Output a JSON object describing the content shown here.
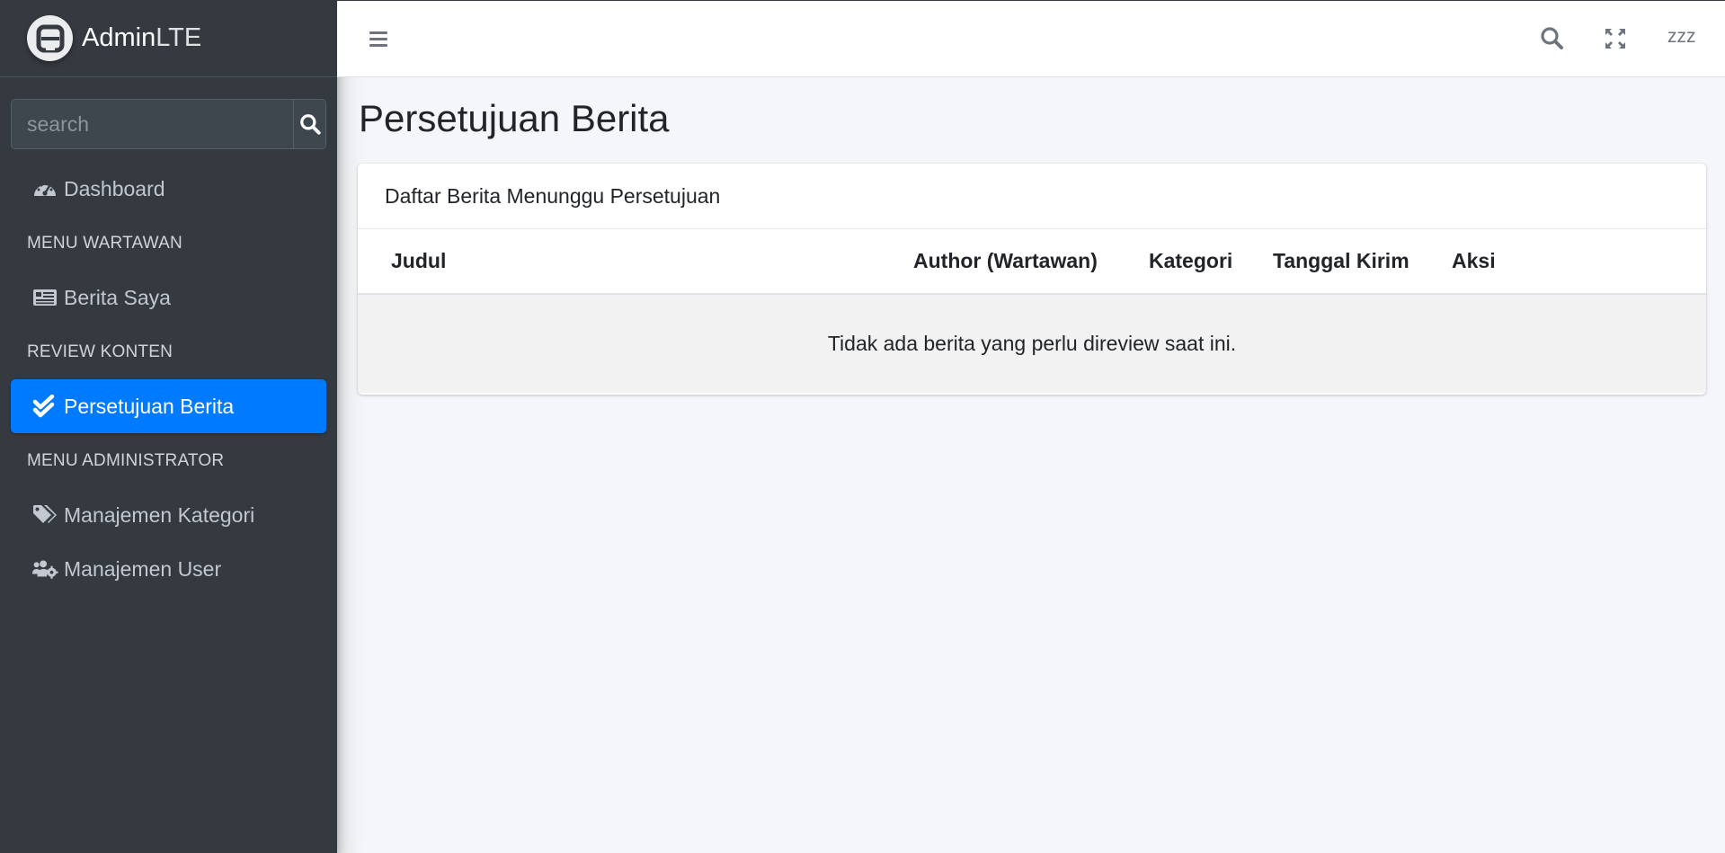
{
  "brand": {
    "name_bold": "Admin",
    "name_light": "LTE"
  },
  "sidebar": {
    "search_placeholder": "search",
    "items": [
      {
        "type": "link",
        "label": "Dashboard",
        "icon": "tachometer-icon",
        "active": false
      },
      {
        "type": "header",
        "label": "MENU WARTAWAN"
      },
      {
        "type": "link",
        "label": "Berita Saya",
        "icon": "newspaper-icon",
        "active": false
      },
      {
        "type": "header",
        "label": "REVIEW KONTEN"
      },
      {
        "type": "link",
        "label": "Persetujuan Berita",
        "icon": "check-double-icon",
        "active": true
      },
      {
        "type": "header",
        "label": "MENU ADMINISTRATOR"
      },
      {
        "type": "link",
        "label": "Manajemen Kategori",
        "icon": "tags-icon",
        "active": false
      },
      {
        "type": "link",
        "label": "Manajemen User",
        "icon": "users-cog-icon",
        "active": false
      }
    ]
  },
  "topbar": {
    "user_label": "zzz"
  },
  "page": {
    "title": "Persetujuan Berita"
  },
  "card": {
    "title": "Daftar Berita Menunggu Persetujuan",
    "columns": [
      "Judul",
      "Author (Wartawan)",
      "Kategori",
      "Tanggal Kirim",
      "Aksi"
    ],
    "empty_message": "Tidak ada berita yang perlu direview saat ini."
  },
  "colors": {
    "sidebar_bg": "#343a40",
    "accent": "#007bff",
    "content_bg": "#f4f6f9"
  }
}
